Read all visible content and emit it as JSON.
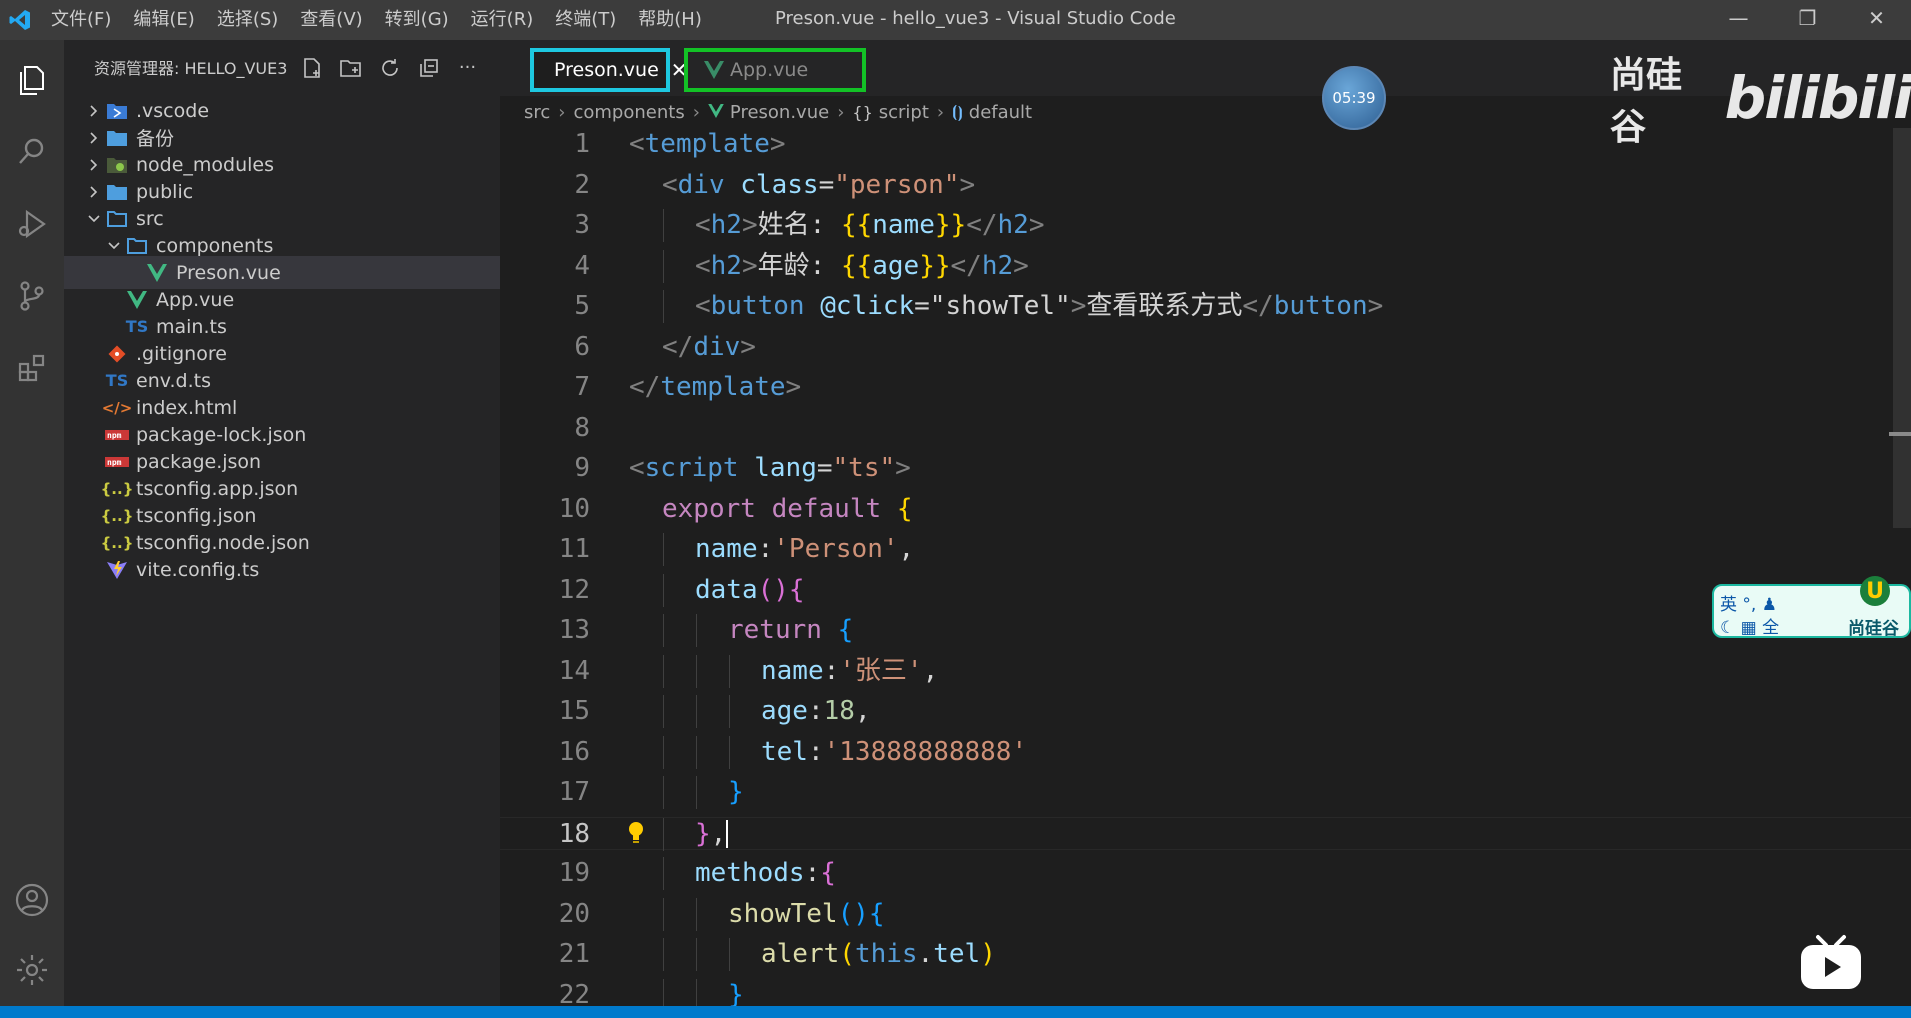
{
  "titlebar": {
    "menu": [
      "文件(F)",
      "编辑(E)",
      "选择(S)",
      "查看(V)",
      "转到(G)",
      "运行(R)",
      "终端(T)",
      "帮助(H)"
    ],
    "title": "Preson.vue - hello_vue3 - Visual Studio Code",
    "minimize": "—",
    "maximize": "❐",
    "close": "✕"
  },
  "sidebar": {
    "title": "资源管理器: HELLO_VUE3",
    "more": "···",
    "tree": [
      {
        "label": ".vscode",
        "depth": 0,
        "kind": "folder",
        "icon": "vscode-folder-icon",
        "expanded": false
      },
      {
        "label": "备份",
        "depth": 0,
        "kind": "folder",
        "icon": "folder-icon",
        "expanded": false
      },
      {
        "label": "node_modules",
        "depth": 0,
        "kind": "folder",
        "icon": "node-folder-icon",
        "expanded": false
      },
      {
        "label": "public",
        "depth": 0,
        "kind": "folder",
        "icon": "folder-icon",
        "expanded": false
      },
      {
        "label": "src",
        "depth": 0,
        "kind": "folder",
        "icon": "folder-open-icon",
        "expanded": true
      },
      {
        "label": "components",
        "depth": 1,
        "kind": "folder",
        "icon": "folder-open-icon",
        "expanded": true
      },
      {
        "label": "Preson.vue",
        "depth": 2,
        "kind": "file",
        "icon": "vue-icon",
        "selected": true
      },
      {
        "label": "App.vue",
        "depth": 1,
        "kind": "file",
        "icon": "vue-icon"
      },
      {
        "label": "main.ts",
        "depth": 1,
        "kind": "file",
        "icon": "ts-icon"
      },
      {
        "label": ".gitignore",
        "depth": 0,
        "kind": "file",
        "icon": "git-icon"
      },
      {
        "label": "env.d.ts",
        "depth": 0,
        "kind": "file",
        "icon": "ts-icon"
      },
      {
        "label": "index.html",
        "depth": 0,
        "kind": "file",
        "icon": "html-icon"
      },
      {
        "label": "package-lock.json",
        "depth": 0,
        "kind": "file",
        "icon": "npm-icon"
      },
      {
        "label": "package.json",
        "depth": 0,
        "kind": "file",
        "icon": "npm-icon"
      },
      {
        "label": "tsconfig.app.json",
        "depth": 0,
        "kind": "file",
        "icon": "json-icon"
      },
      {
        "label": "tsconfig.json",
        "depth": 0,
        "kind": "file",
        "icon": "json-icon"
      },
      {
        "label": "tsconfig.node.json",
        "depth": 0,
        "kind": "file",
        "icon": "json-icon"
      },
      {
        "label": "vite.config.ts",
        "depth": 0,
        "kind": "file",
        "icon": "vite-icon"
      }
    ]
  },
  "tabs": {
    "active": {
      "label": "Preson.vue",
      "close": "✕"
    },
    "other": {
      "label": "App.vue"
    }
  },
  "overlay": {
    "timer": "05:39",
    "brand_cn": "尚硅谷",
    "brand_site": "bilibili",
    "ime_row1": "英 °, ♟",
    "ime_row2": "☾ ▦ 全",
    "ime_brand": "尚硅谷",
    "ime_logo": "U"
  },
  "breadcrumb": [
    "src",
    "components",
    "Preson.vue",
    "script",
    "default"
  ],
  "editor": {
    "current_line": 18,
    "lines": [
      {
        "n": "1",
        "indent": 0,
        "tokens": [
          [
            "t-br",
            "<"
          ],
          [
            "t-tag",
            "template"
          ],
          [
            "t-br",
            ">"
          ]
        ]
      },
      {
        "n": "2",
        "indent": 1,
        "tokens": [
          [
            "t-br",
            "<"
          ],
          [
            "t-tag",
            "div"
          ],
          [
            "t-txt",
            " "
          ],
          [
            "t-attr",
            "class"
          ],
          [
            "t-txt",
            "="
          ],
          [
            "t-str",
            "\"person\""
          ],
          [
            "t-br",
            ">"
          ]
        ]
      },
      {
        "n": "3",
        "indent": 2,
        "tokens": [
          [
            "t-br",
            "<"
          ],
          [
            "t-tag",
            "h2"
          ],
          [
            "t-br",
            ">"
          ],
          [
            "t-txt",
            "姓名: "
          ],
          [
            "t-y",
            "{{"
          ],
          [
            "t-attr",
            "name"
          ],
          [
            "t-y",
            "}}"
          ],
          [
            "t-br",
            "</"
          ],
          [
            "t-tag",
            "h2"
          ],
          [
            "t-br",
            ">"
          ]
        ]
      },
      {
        "n": "4",
        "indent": 2,
        "tokens": [
          [
            "t-br",
            "<"
          ],
          [
            "t-tag",
            "h2"
          ],
          [
            "t-br",
            ">"
          ],
          [
            "t-txt",
            "年龄: "
          ],
          [
            "t-y",
            "{{"
          ],
          [
            "t-attr",
            "age"
          ],
          [
            "t-y",
            "}}"
          ],
          [
            "t-br",
            "</"
          ],
          [
            "t-tag",
            "h2"
          ],
          [
            "t-br",
            ">"
          ]
        ]
      },
      {
        "n": "5",
        "indent": 2,
        "tokens": [
          [
            "t-br",
            "<"
          ],
          [
            "t-tag",
            "button"
          ],
          [
            "t-txt",
            " "
          ],
          [
            "t-attr",
            "@click"
          ],
          [
            "t-txt",
            "=\"showTel\""
          ],
          [
            "t-br",
            ">"
          ],
          [
            "t-txt",
            "查看联系方式"
          ],
          [
            "t-br",
            "</"
          ],
          [
            "t-tag",
            "button"
          ],
          [
            "t-br",
            ">"
          ]
        ]
      },
      {
        "n": "6",
        "indent": 1,
        "tokens": [
          [
            "t-br",
            "</"
          ],
          [
            "t-tag",
            "div"
          ],
          [
            "t-br",
            ">"
          ]
        ]
      },
      {
        "n": "7",
        "indent": 0,
        "tokens": [
          [
            "t-br",
            "</"
          ],
          [
            "t-tag",
            "template"
          ],
          [
            "t-br",
            ">"
          ]
        ]
      },
      {
        "n": "8",
        "indent": 0,
        "tokens": []
      },
      {
        "n": "9",
        "indent": 0,
        "tokens": [
          [
            "t-br",
            "<"
          ],
          [
            "t-tag",
            "script"
          ],
          [
            "t-txt",
            " "
          ],
          [
            "t-attr",
            "lang"
          ],
          [
            "t-txt",
            "="
          ],
          [
            "t-str",
            "\"ts\""
          ],
          [
            "t-br",
            ">"
          ]
        ]
      },
      {
        "n": "10",
        "indent": 1,
        "tokens": [
          [
            "t-kw",
            "export default "
          ],
          [
            "t-y",
            "{"
          ]
        ]
      },
      {
        "n": "11",
        "indent": 2,
        "tokens": [
          [
            "t-attr",
            "name"
          ],
          [
            "t-txt",
            ":"
          ],
          [
            "t-str",
            "'Person'"
          ],
          [
            "t-txt",
            ","
          ]
        ]
      },
      {
        "n": "12",
        "indent": 2,
        "tokens": [
          [
            "t-attr",
            "data"
          ],
          [
            "t-p",
            "(){"
          ]
        ]
      },
      {
        "n": "13",
        "indent": 3,
        "tokens": [
          [
            "t-kw",
            "return "
          ],
          [
            "t-b",
            "{"
          ]
        ]
      },
      {
        "n": "14",
        "indent": 4,
        "tokens": [
          [
            "t-attr",
            "name"
          ],
          [
            "t-txt",
            ":"
          ],
          [
            "t-str",
            "'张三'"
          ],
          [
            "t-txt",
            ","
          ]
        ]
      },
      {
        "n": "15",
        "indent": 4,
        "tokens": [
          [
            "t-attr",
            "age"
          ],
          [
            "t-txt",
            ":"
          ],
          [
            "t-num",
            "18"
          ],
          [
            "t-txt",
            ","
          ]
        ]
      },
      {
        "n": "16",
        "indent": 4,
        "tokens": [
          [
            "t-attr",
            "tel"
          ],
          [
            "t-txt",
            ":"
          ],
          [
            "t-str",
            "'13888888888'"
          ]
        ]
      },
      {
        "n": "17",
        "indent": 3,
        "tokens": [
          [
            "t-b",
            "}"
          ]
        ]
      },
      {
        "n": "18",
        "indent": 2,
        "tokens": [
          [
            "t-p",
            "}"
          ],
          [
            "t-txt",
            ","
          ]
        ],
        "cursor": true,
        "bulb": true
      },
      {
        "n": "19",
        "indent": 2,
        "tokens": [
          [
            "t-attr",
            "methods"
          ],
          [
            "t-txt",
            ":"
          ],
          [
            "t-p",
            "{"
          ]
        ]
      },
      {
        "n": "20",
        "indent": 3,
        "tokens": [
          [
            "t-fn",
            "showTel"
          ],
          [
            "t-b",
            "(){"
          ]
        ]
      },
      {
        "n": "21",
        "indent": 4,
        "tokens": [
          [
            "t-fn",
            "alert"
          ],
          [
            "t-y",
            "("
          ],
          [
            "t-this",
            "this"
          ],
          [
            "t-txt",
            "."
          ],
          [
            "t-attr",
            "tel"
          ],
          [
            "t-y",
            ")"
          ]
        ]
      },
      {
        "n": "22",
        "indent": 3,
        "tokens": [
          [
            "t-b",
            "}"
          ]
        ]
      }
    ]
  }
}
